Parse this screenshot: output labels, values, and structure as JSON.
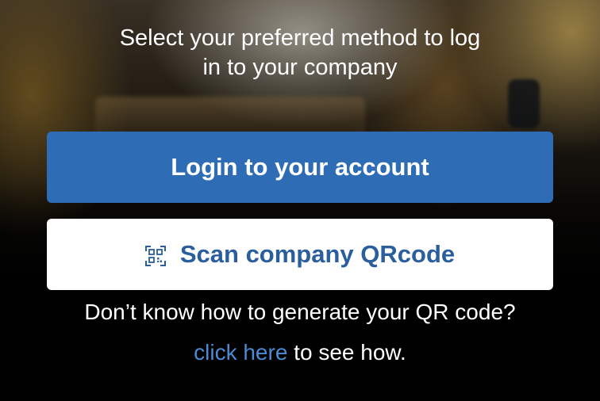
{
  "header": {
    "title_line1": "Select your preferred method to log",
    "title_line2": "in to your company"
  },
  "actions": {
    "login_label": "Login to your account",
    "scan_label": "Scan company QRcode",
    "scan_icon": "qr-code-icon"
  },
  "help": {
    "question": "Don’t know how to generate your QR code?",
    "link_text": "click here",
    "link_suffix": " to see how."
  },
  "colors": {
    "primary_button": "#2f6cb6",
    "secondary_button_bg": "#ffffff",
    "secondary_button_text": "#2a5e9c",
    "link": "#4a8bd4",
    "text": "#ffffff"
  }
}
